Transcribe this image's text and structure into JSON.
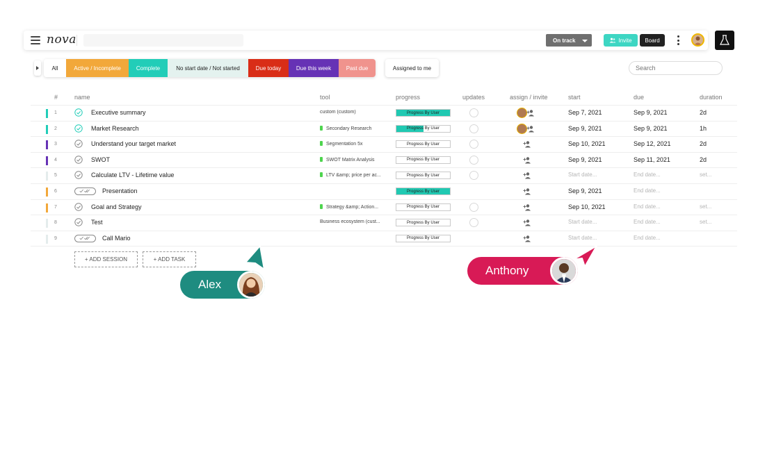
{
  "header": {
    "logo": "nova",
    "status": "On track",
    "invite_label": "Invite",
    "board_label": "Board"
  },
  "filters": [
    {
      "label": "All",
      "bg": "#ffffff",
      "fg": "#222222"
    },
    {
      "label": "Active / Incomplete",
      "bg": "#f2a83a",
      "fg": "#ffffff"
    },
    {
      "label": "Complete",
      "bg": "#22cdb8",
      "fg": "#ffffff"
    },
    {
      "label": "No start date / Not started",
      "bg": "#e4f2ef",
      "fg": "#222222"
    },
    {
      "label": "Due today",
      "bg": "#d92d17",
      "fg": "#ffffff"
    },
    {
      "label": "Due this week",
      "bg": "#6632b5",
      "fg": "#ffffff"
    },
    {
      "label": "Past due",
      "bg": "#f0938d",
      "fg": "#ffffff"
    }
  ],
  "assigned_label": "Assigned to me",
  "search": {
    "placeholder": "Search"
  },
  "columns": {
    "num": "#",
    "name": "name",
    "tool": "tool",
    "progress": "progress",
    "updates": "updates",
    "assign": "assign / invite",
    "start": "start",
    "due": "due",
    "duration": "duration"
  },
  "rows": [
    {
      "num": "1",
      "color": "#22cdb8",
      "check": "green",
      "name": "Executive summary",
      "tool": "custom (custom)",
      "tool_dot": false,
      "progress": "Progress By User",
      "progress_fill": 1.0,
      "updates": true,
      "avatar": true,
      "start": "Sep 7, 2021",
      "due": "Sep 9, 2021",
      "duration": "2d"
    },
    {
      "num": "2",
      "color": "#22cdb8",
      "check": "green",
      "name": "Market Research",
      "tool": "Secondary Research",
      "tool_dot": true,
      "progress": "Progress By User",
      "progress_fill": 0.5,
      "updates": true,
      "avatar": true,
      "start": "Sep 9, 2021",
      "due": "Sep 9, 2021",
      "duration": "1h"
    },
    {
      "num": "3",
      "color": "#6632b5",
      "check": "grey",
      "name": "Understand your target market",
      "tool": "Segmentation 5x",
      "tool_dot": true,
      "progress": "Progress By User",
      "progress_fill": 0,
      "updates": true,
      "avatar": false,
      "start": "Sep 10, 2021",
      "due": "Sep 12, 2021",
      "duration": "2d"
    },
    {
      "num": "4",
      "color": "#6632b5",
      "check": "grey",
      "name": "SWOT",
      "tool": "SWOT Matrix Analysis",
      "tool_dot": true,
      "progress": "Progress By User",
      "progress_fill": 0,
      "updates": true,
      "avatar": false,
      "start": "Sep 9, 2021",
      "due": "Sep 11, 2021",
      "duration": "2d"
    },
    {
      "num": "5",
      "color": "#e4ecec",
      "check": "grey",
      "name": "Calculate LTV - Lifetime value",
      "tool": "LTV &amp; price per ac...",
      "tool_dot": true,
      "progress": "Progress By User",
      "progress_fill": 0,
      "updates": true,
      "avatar": false,
      "start": "Start date...",
      "due": "End date...",
      "duration": "set..."
    },
    {
      "num": "6",
      "color": "#f2a83a",
      "check": "multi",
      "name": "Presentation",
      "tool": "",
      "tool_dot": false,
      "progress": "Progress By User",
      "progress_fill": 1.0,
      "updates": false,
      "avatar": false,
      "start": "Sep 9, 2021",
      "due": "End date...",
      "duration": ""
    },
    {
      "num": "7",
      "color": "#f2a83a",
      "check": "grey",
      "name": "Goal and Strategy",
      "tool": "Strategy &amp; Action...",
      "tool_dot": true,
      "progress": "Progress By User",
      "progress_fill": 0,
      "updates": true,
      "avatar": false,
      "start": "Sep 10, 2021",
      "due": "End date...",
      "duration": "set..."
    },
    {
      "num": "8",
      "color": "#e4ecec",
      "check": "grey",
      "name": "Test",
      "tool": "Business ecosystem (cust...",
      "tool_dot": false,
      "progress": "Progress By User",
      "progress_fill": 0,
      "updates": true,
      "avatar": false,
      "start": "Start date...",
      "due": "End date...",
      "duration": "set..."
    },
    {
      "num": "9",
      "color": "#e4ecec",
      "check": "multi",
      "name": "Call Mario",
      "tool": "",
      "tool_dot": false,
      "progress": "Progress By User",
      "progress_fill": 0,
      "updates": false,
      "avatar": false,
      "start": "Start date...",
      "due": "End date...",
      "duration": ""
    }
  ],
  "actions": {
    "add_session": "+ ADD SESSION",
    "add_task": "+ ADD TASK"
  },
  "cursors": [
    {
      "name": "Alex",
      "color": "#1e8c80"
    },
    {
      "name": "Anthony",
      "color": "#d81a56"
    }
  ]
}
